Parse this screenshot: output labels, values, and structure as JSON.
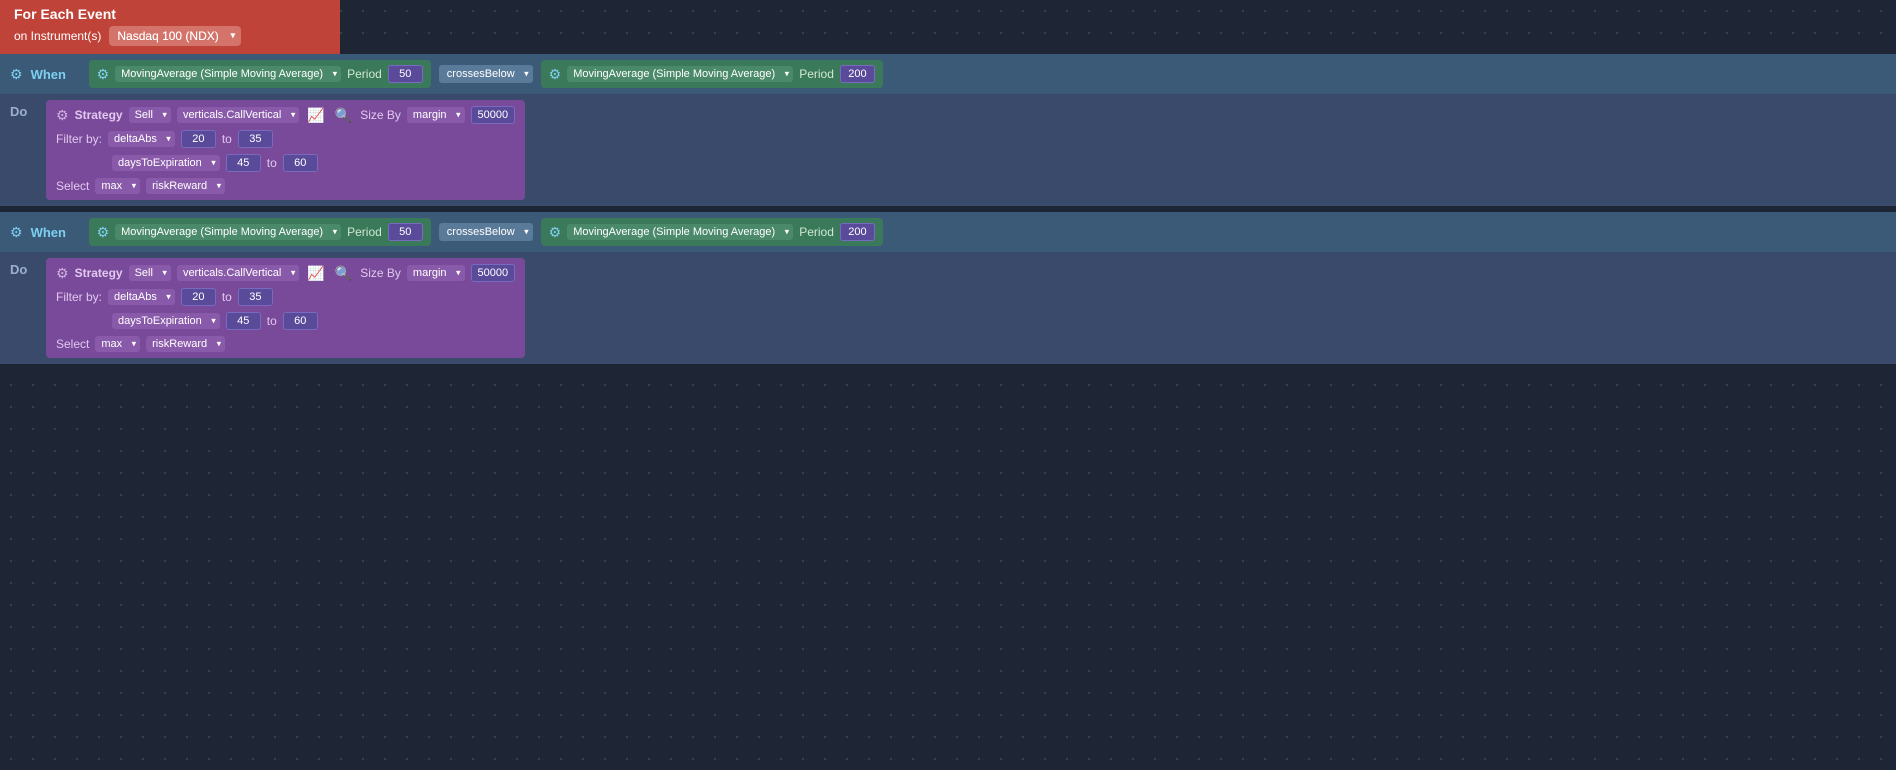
{
  "header": {
    "title": "For Each Event",
    "on_label": "on Instrument(s)",
    "instrument": "Nasdaq 100 (NDX)"
  },
  "blocks": [
    {
      "id": "block1",
      "when": {
        "label": "When",
        "condition1": {
          "indicator": "MovingAverage (Simple Moving Average)",
          "period_label": "Period",
          "period_value": "50"
        },
        "crosses": "crossesBelow",
        "condition2": {
          "indicator": "MovingAverage (Simple Moving Average)",
          "period_label": "Period",
          "period_value": "200"
        }
      },
      "do": {
        "label": "Do",
        "strategy_label": "Strategy",
        "action": "Sell",
        "strategy_name": "verticals.CallVertical",
        "size_by_label": "Size By",
        "size_by": "margin",
        "size_value": "50000",
        "filter_label": "Filter by:",
        "filters": [
          {
            "field": "deltaAbs",
            "from": "20",
            "to_text": "to",
            "to": "35"
          },
          {
            "field": "daysToExpiration",
            "from": "45",
            "to_text": "to",
            "to": "60"
          }
        ],
        "select_label": "Select",
        "select_method": "max",
        "select_field": "riskReward"
      }
    },
    {
      "id": "block2",
      "when": {
        "label": "When",
        "condition1": {
          "indicator": "MovingAverage (Simple Moving Average)",
          "period_label": "Period",
          "period_value": "50"
        },
        "crosses": "crossesBelow",
        "condition2": {
          "indicator": "MovingAverage (Simple Moving Average)",
          "period_label": "Period",
          "period_value": "200"
        }
      },
      "do": {
        "label": "Do",
        "strategy_label": "Strategy",
        "action": "Sell",
        "strategy_name": "verticals.CallVertical",
        "size_by_label": "Size By",
        "size_by": "margin",
        "size_value": "50000",
        "filter_label": "Filter by:",
        "filters": [
          {
            "field": "deltaAbs",
            "from": "20",
            "to_text": "to",
            "to": "35"
          },
          {
            "field": "daysToExpiration",
            "from": "45",
            "to_text": "to",
            "to": "60"
          }
        ],
        "select_label": "Select",
        "select_method": "max",
        "select_field": "riskReward"
      }
    }
  ]
}
